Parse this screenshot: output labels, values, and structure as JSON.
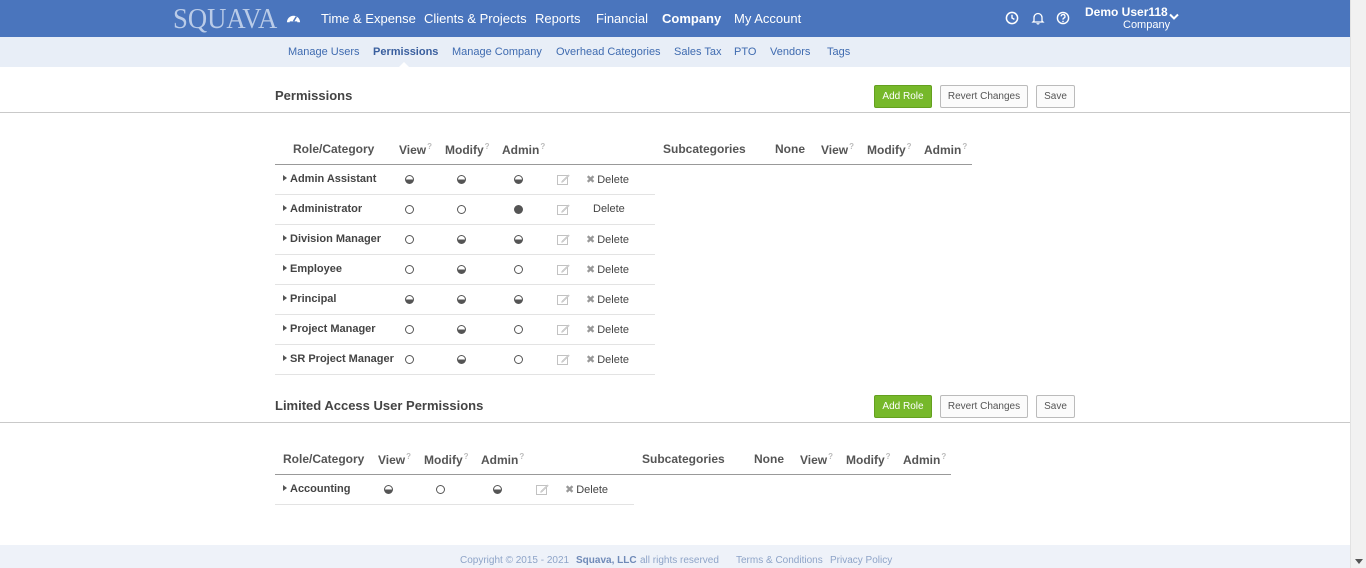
{
  "app": {
    "logo": "SQUAVA"
  },
  "nav": {
    "items": [
      "Time & Expense",
      "Clients & Projects",
      "Reports",
      "Financial",
      "Company",
      "My Account"
    ],
    "active": "Company"
  },
  "user": {
    "name": "Demo User118",
    "subtitle": "Company"
  },
  "subnav": {
    "items": [
      "Manage Users",
      "Permissions",
      "Manage Company",
      "Overhead Categories",
      "Sales Tax",
      "PTO",
      "Vendors",
      "Tags"
    ],
    "active": "Permissions"
  },
  "buttons": {
    "add_role": "Add Role",
    "revert": "Revert Changes",
    "save": "Save"
  },
  "table_headers": {
    "role": "Role/Category",
    "view": "View",
    "modify": "Modify",
    "admin": "Admin",
    "subcategories": "Subcategories",
    "none": "None",
    "help": "?"
  },
  "delete_label": "Delete",
  "sections": [
    {
      "title": "Permissions",
      "roles": [
        {
          "name": "Admin Assistant",
          "view": "partial",
          "modify": "partial",
          "admin": "partial",
          "expandable": true,
          "delete_icon": true
        },
        {
          "name": "Administrator",
          "view": "none",
          "modify": "none",
          "admin": "full",
          "expandable": true,
          "delete_icon": false
        },
        {
          "name": "Division Manager",
          "view": "none",
          "modify": "partial",
          "admin": "partial",
          "expandable": true,
          "delete_icon": true
        },
        {
          "name": "Employee",
          "view": "none",
          "modify": "partial",
          "admin": "none",
          "expandable": true,
          "delete_icon": true
        },
        {
          "name": "Principal",
          "view": "partial",
          "modify": "partial",
          "admin": "partial",
          "expandable": true,
          "delete_icon": true
        },
        {
          "name": "Project Manager",
          "view": "none",
          "modify": "partial",
          "admin": "none",
          "expandable": true,
          "delete_icon": true
        },
        {
          "name": "SR Project Manager",
          "view": "none",
          "modify": "partial",
          "admin": "none",
          "expandable": true,
          "delete_icon": true
        }
      ]
    },
    {
      "title": "Limited Access User Permissions",
      "roles": [
        {
          "name": "Accounting",
          "view": "partial",
          "modify": "none",
          "admin": "partial",
          "expandable": true,
          "delete_icon": true
        }
      ]
    }
  ],
  "footer": {
    "copyright": "Copyright © 2015 - 2021",
    "company": "Squava, LLC",
    "rights": "all rights reserved",
    "terms": "Terms & Conditions",
    "privacy": "Privacy Policy"
  },
  "colors": {
    "nav_bg": "#4a75bd",
    "subnav_bg": "#e8eef7",
    "accent_green": "#76b82a"
  }
}
